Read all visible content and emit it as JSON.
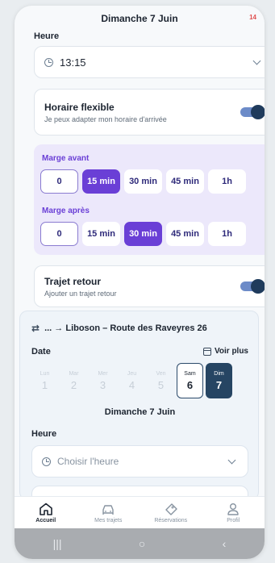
{
  "header": {
    "date": "Dimanche 7 Juin",
    "battery": "14"
  },
  "depart": {
    "heure_label": "Heure",
    "heure_value": "13:15"
  },
  "flexible": {
    "title": "Horaire flexible",
    "subtitle": "Je peux adapter mon horaire d'arrivée",
    "enabled": true
  },
  "marges": {
    "avant_label": "Marge avant",
    "apres_label": "Marge après",
    "options": [
      "0",
      "15 min",
      "30 min",
      "45 min",
      "1h"
    ],
    "avant_selected": "15 min",
    "apres_selected": "30 min"
  },
  "retour": {
    "title": "Trajet retour",
    "subtitle": "Ajouter un trajet retour",
    "enabled": true,
    "route": "... → Liboson – Route des Raveyres 26",
    "date_label": "Date",
    "voir_plus": "Voir plus",
    "days": [
      {
        "name": "Lun",
        "num": "1",
        "state": "disabled"
      },
      {
        "name": "Mar",
        "num": "2",
        "state": "disabled"
      },
      {
        "name": "Mer",
        "num": "3",
        "state": "disabled"
      },
      {
        "name": "Jeu",
        "num": "4",
        "state": "disabled"
      },
      {
        "name": "Ven",
        "num": "5",
        "state": "disabled"
      },
      {
        "name": "Sam",
        "num": "6",
        "state": "available"
      },
      {
        "name": "Dim",
        "num": "7",
        "state": "selected"
      }
    ],
    "selected_date": "Dimanche 7 Juin",
    "heure_label": "Heure",
    "heure_placeholder": "Choisir l'heure"
  },
  "nav": [
    {
      "label": "Accueil",
      "icon": "home-icon",
      "active": true
    },
    {
      "label": "Mes trajets",
      "icon": "car-icon",
      "active": false
    },
    {
      "label": "Réservations",
      "icon": "ticket-icon",
      "active": false
    },
    {
      "label": "Profil",
      "icon": "user-icon",
      "active": false
    }
  ],
  "colors": {
    "accent": "#6a3fd6",
    "primary_dark": "#264563",
    "panel": "#ece8fb"
  }
}
